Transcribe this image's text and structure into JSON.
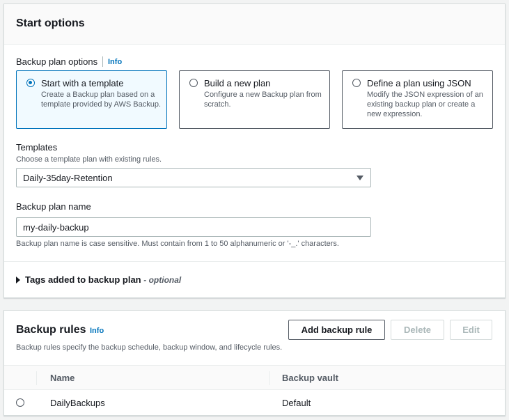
{
  "start_options": {
    "title": "Start options",
    "backup_plan_options_label": "Backup plan options",
    "info_label": "Info",
    "tiles": [
      {
        "title": "Start with a template",
        "description": "Create a Backup plan based on a template provided by AWS Backup.",
        "selected": true
      },
      {
        "title": "Build a new plan",
        "description": "Configure a new Backup plan from scratch.",
        "selected": false
      },
      {
        "title": "Define a plan using JSON",
        "description": "Modify the JSON expression of an existing backup plan or create a new expression.",
        "selected": false
      }
    ],
    "templates_label": "Templates",
    "templates_description": "Choose a template plan with existing rules.",
    "template_selected": "Daily-35day-Retention",
    "plan_name_label": "Backup plan name",
    "plan_name_value": "my-daily-backup",
    "plan_name_hint": "Backup plan name is case sensitive. Must contain from 1 to 50 alphanumeric or '-_.' characters.",
    "tags_label": "Tags added to backup plan",
    "tags_optional": "- optional"
  },
  "backup_rules": {
    "title": "Backup rules",
    "info_label": "Info",
    "description": "Backup rules specify the backup schedule, backup window, and lifecycle rules.",
    "add_button": "Add backup rule",
    "delete_button": "Delete",
    "edit_button": "Edit",
    "columns": [
      "Name",
      "Backup vault"
    ],
    "rows": [
      {
        "name": "DailyBackups",
        "vault": "Default"
      }
    ]
  },
  "colors": {
    "accent": "#0073bb",
    "selected_tile_bg": "#f1faff",
    "text": "#16191f",
    "muted": "#545b64"
  }
}
